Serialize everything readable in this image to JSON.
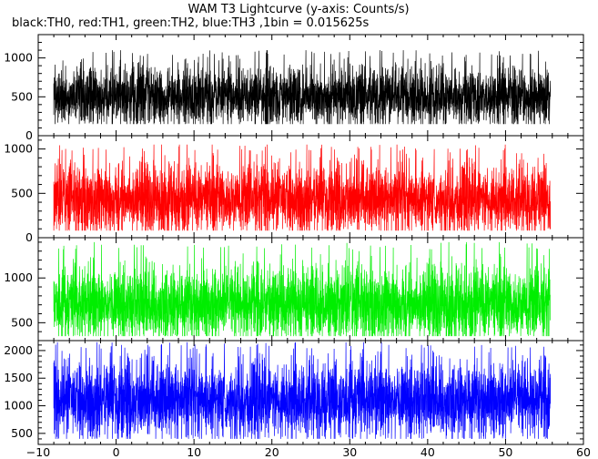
{
  "chart_data": {
    "type": "line",
    "title": "WAM T3 Lightcurve (y-axis: Counts/s)",
    "subtitle": "black:TH0, red:TH1, green:TH2, blue:TH3 ,1bin = 0.015625s",
    "x_range": [
      -10,
      60
    ],
    "x_ticks": [
      -10,
      0,
      10,
      20,
      30,
      40,
      50,
      60
    ],
    "x_tick_labels": [
      "−10",
      "0",
      "10",
      "20",
      "30",
      "40",
      "50",
      "60"
    ],
    "data_x_range": [
      -8.0,
      55.8
    ],
    "bin_size_s": 0.015625,
    "panels": [
      {
        "series": "TH0",
        "color": "#000000",
        "ylim": [
          0,
          1300
        ],
        "y_ticks": [
          0,
          500,
          1000
        ],
        "y_tick_labels": [
          "0",
          "500",
          "1000"
        ],
        "typical_mean": 500,
        "typical_min": 150,
        "typical_max": 1100
      },
      {
        "series": "TH1",
        "color": "#ff0000",
        "ylim": [
          0,
          1150
        ],
        "y_ticks": [
          0,
          500,
          1000
        ],
        "y_tick_labels": [
          "0",
          "500",
          "1000"
        ],
        "typical_mean": 430,
        "typical_min": 80,
        "typical_max": 1050
      },
      {
        "series": "TH2",
        "color": "#00ee00",
        "ylim": [
          300,
          1450
        ],
        "y_ticks": [
          500,
          1000
        ],
        "y_tick_labels": [
          "500",
          "1000"
        ],
        "typical_mean": 700,
        "typical_min": 350,
        "typical_max": 1400
      },
      {
        "series": "TH3",
        "color": "#0000ff",
        "ylim": [
          300,
          2180
        ],
        "y_ticks": [
          500,
          1000,
          1500,
          2000
        ],
        "y_tick_labels": [
          "500",
          "1000",
          "1500",
          "2000"
        ],
        "typical_mean": 1100,
        "typical_min": 400,
        "typical_max": 2150
      }
    ]
  }
}
